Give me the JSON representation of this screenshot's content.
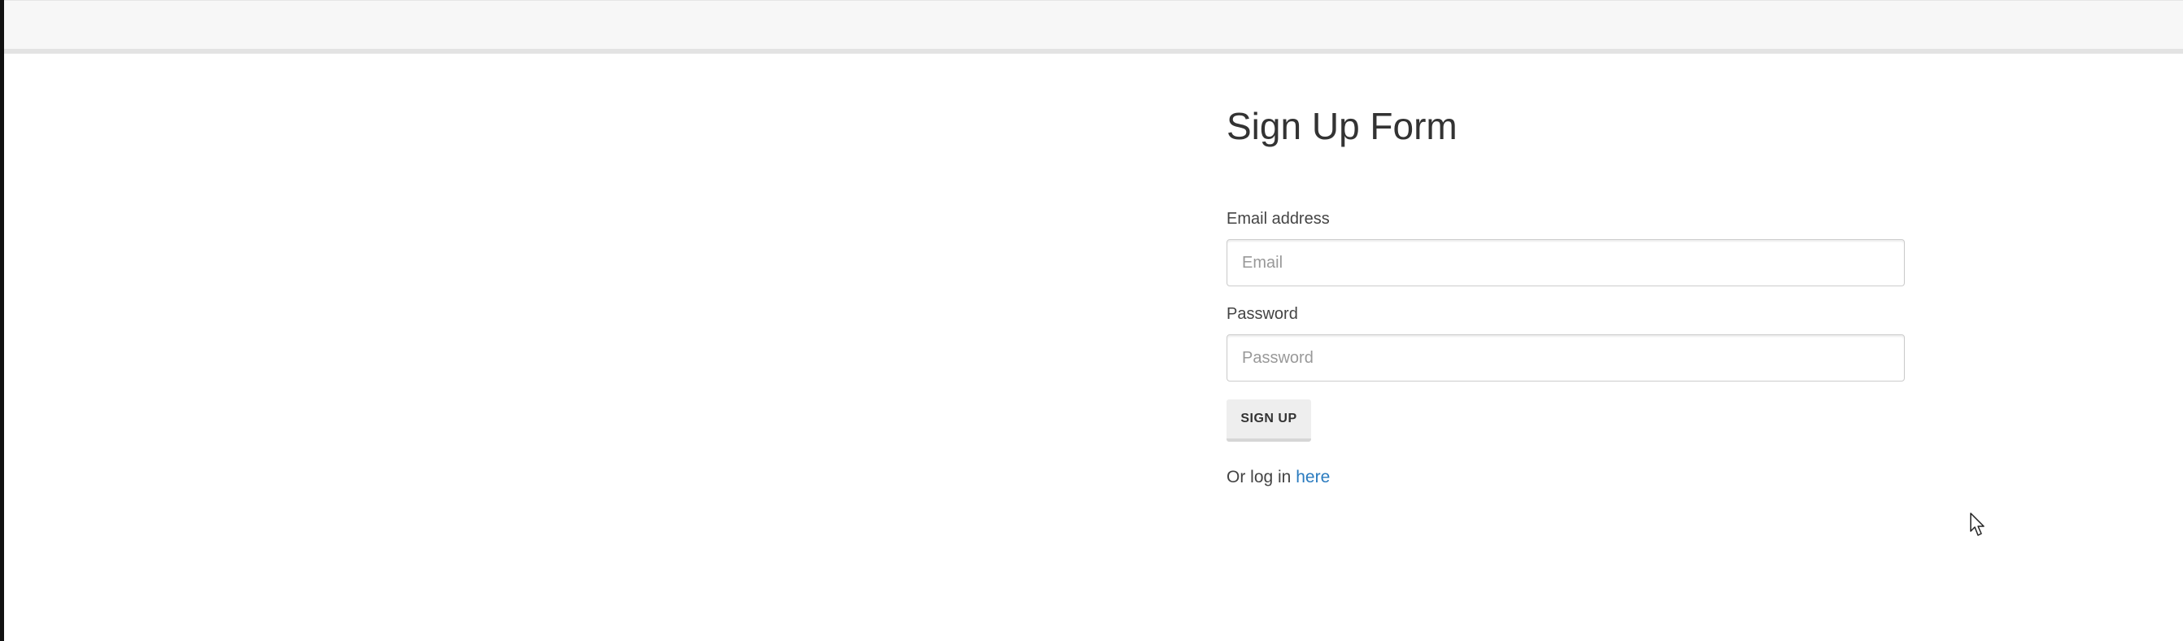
{
  "form": {
    "title": "Sign Up Form",
    "email": {
      "label": "Email address",
      "placeholder": "Email",
      "value": ""
    },
    "password": {
      "label": "Password",
      "placeholder": "Password",
      "value": ""
    },
    "submit_label": "SIGN UP",
    "login_prompt": "Or log in",
    "login_link": "here"
  },
  "colors": {
    "link": "#2a7bbf",
    "navbar": "#f7f7f7",
    "button": "#eeeeee"
  }
}
